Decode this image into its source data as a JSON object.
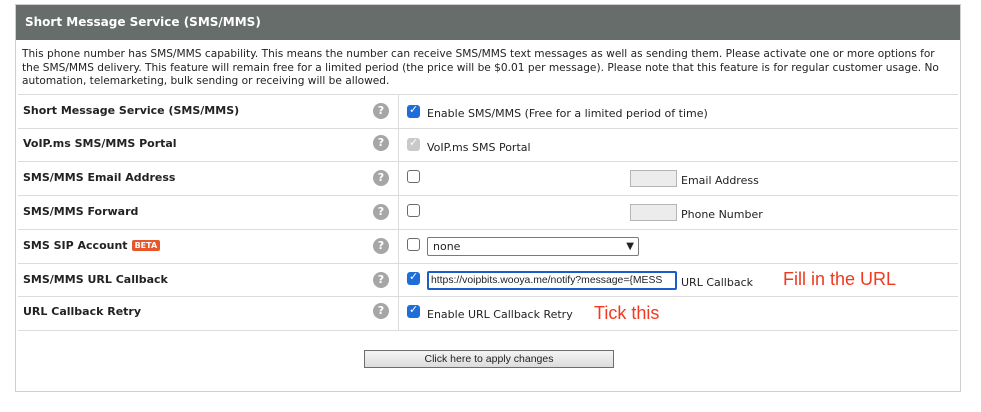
{
  "section": {
    "title": "Short Message Service (SMS/MMS)",
    "description": "This phone number has SMS/MMS capability. This means the number can receive SMS/MMS text messages as well as sending them. Please activate one or more options for the SMS/MMS delivery. This feature will remain free for a limited period (the price will be $0.01 per message). Please note that this feature is for regular customer usage. No automation, telemarketing, bulk sending or receiving will be allowed."
  },
  "help_icon": "?",
  "rows": {
    "sms": {
      "label": "Short Message Service (SMS/MMS)",
      "checked": true,
      "text": "Enable SMS/MMS (Free for a limited period of time)"
    },
    "portal": {
      "label": "VoIP.ms SMS/MMS Portal",
      "checked": true,
      "disabled": true,
      "text": "VoIP.ms SMS Portal"
    },
    "email": {
      "label": "SMS/MMS Email Address",
      "checked": false,
      "value": "",
      "text": "Email Address"
    },
    "forward": {
      "label": "SMS/MMS Forward",
      "checked": false,
      "value": "",
      "text": "Phone Number"
    },
    "sip": {
      "label": "SMS SIP Account",
      "badge": "BETA",
      "checked": false,
      "selected": "none"
    },
    "callback": {
      "label": "SMS/MMS URL Callback",
      "checked": true,
      "value": "https://voipbits.wooya.me/notify?message={MESS",
      "text": "URL Callback"
    },
    "retry": {
      "label": "URL Callback Retry",
      "checked": true,
      "text": "Enable URL Callback Retry"
    }
  },
  "annotations": {
    "fill_url": "Fill in the URL",
    "tick": "Tick this"
  },
  "apply_button": "Click here to apply changes",
  "colors": {
    "header_bg": "#666d6a",
    "checkbox_on": "#1f6ed8",
    "annotation": "#f0391e",
    "badge": "#e8572a"
  }
}
